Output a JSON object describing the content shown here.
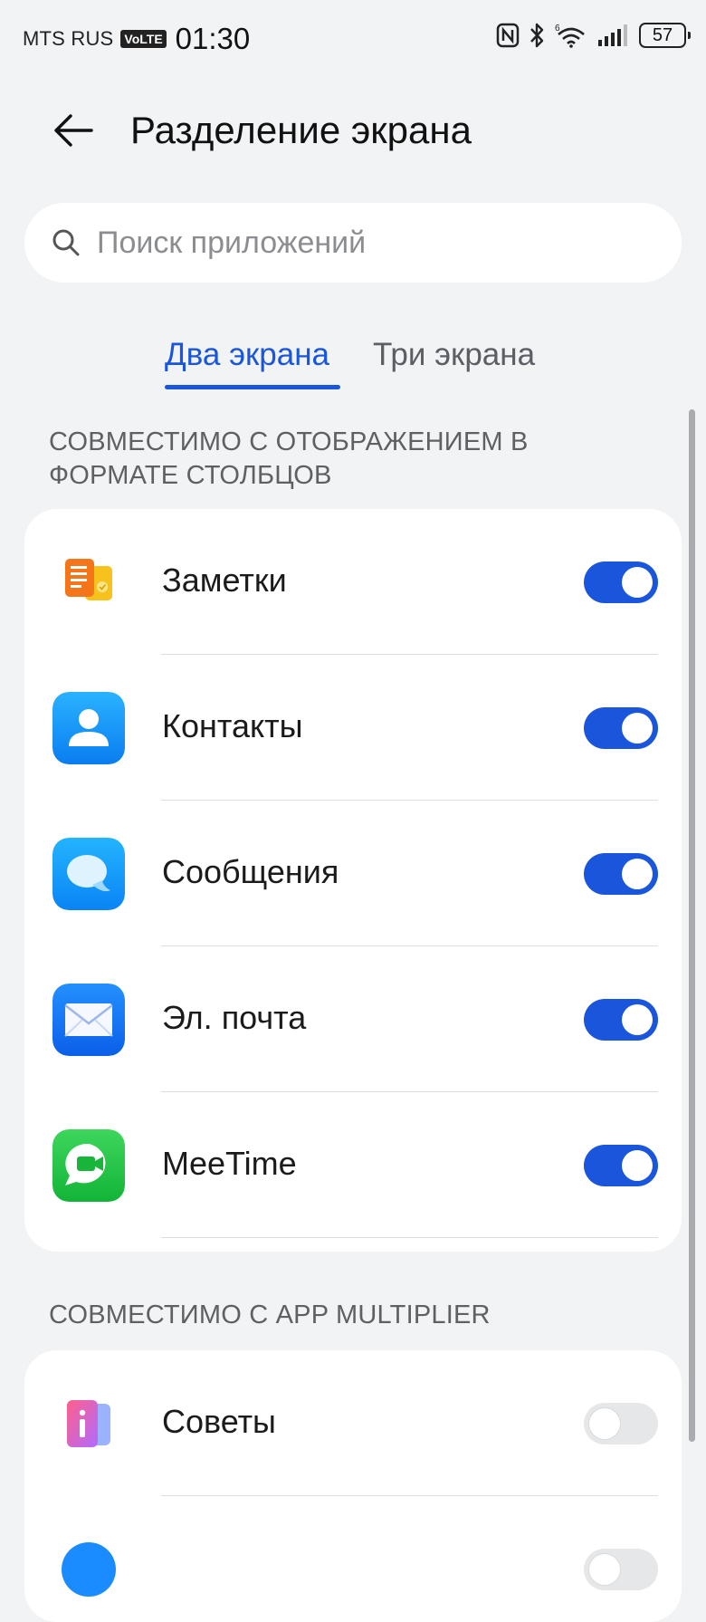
{
  "status_bar": {
    "carrier": "MTS RUS",
    "volte": "VoLTE",
    "time": "01:30",
    "wifi_badge": "6",
    "battery": "57"
  },
  "header": {
    "title": "Разделение экрана"
  },
  "search": {
    "placeholder": "Поиск приложений"
  },
  "tabs": [
    {
      "label": "Два экрана",
      "active": true
    },
    {
      "label": "Три экрана",
      "active": false
    }
  ],
  "sections": [
    {
      "title": "СОВМЕСТИМО С ОТОБРАЖЕНИЕМ В ФОРМАТЕ СТОЛБЦОВ",
      "apps": [
        {
          "name": "Заметки",
          "icon": "notes-icon",
          "enabled": true
        },
        {
          "name": "Контакты",
          "icon": "contacts-icon",
          "enabled": true
        },
        {
          "name": "Сообщения",
          "icon": "messages-icon",
          "enabled": true
        },
        {
          "name": "Эл. почта",
          "icon": "email-icon",
          "enabled": true
        },
        {
          "name": "MeeTime",
          "icon": "meetime-icon",
          "enabled": true
        }
      ]
    },
    {
      "title": "СОВМЕСТИМО С APP MULTIPLIER",
      "apps": [
        {
          "name": "Советы",
          "icon": "tips-icon",
          "enabled": false
        }
      ]
    }
  ],
  "colors": {
    "accent": "#1a56db",
    "background": "#f1f3f5",
    "toggle_off": "#e6e7e9"
  }
}
